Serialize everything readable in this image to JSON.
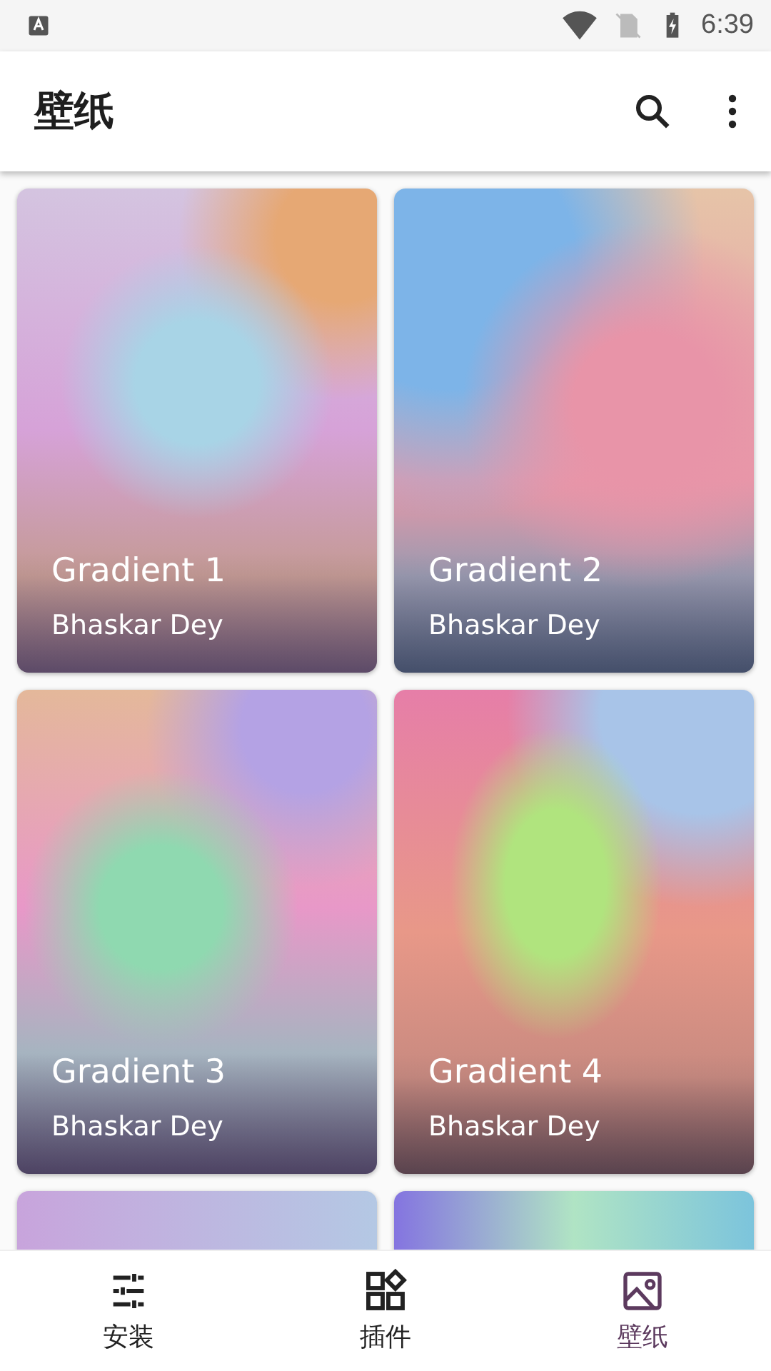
{
  "status_bar": {
    "time": "6:39"
  },
  "app_bar": {
    "title": "壁纸"
  },
  "wallpapers": [
    {
      "kind": "card",
      "title": "Gradient 1",
      "author": "Bhaskar Dey"
    },
    {
      "kind": "card",
      "title": "Gradient 2",
      "author": "Bhaskar Dey"
    },
    {
      "kind": "card",
      "title": "Gradient 3",
      "author": "Bhaskar Dey"
    },
    {
      "kind": "card",
      "title": "Gradient 4",
      "author": "Bhaskar Dey"
    },
    {
      "kind": "peek"
    },
    {
      "kind": "peek"
    }
  ],
  "bottom_nav": [
    {
      "label": "安装",
      "selected": false
    },
    {
      "label": "插件",
      "selected": false
    },
    {
      "label": "壁纸",
      "selected": true
    }
  ]
}
